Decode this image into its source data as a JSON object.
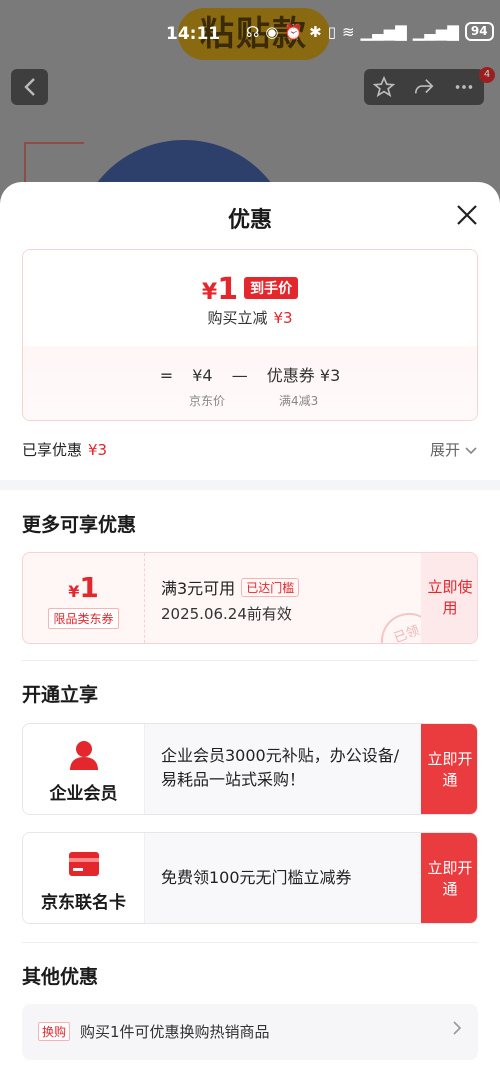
{
  "background": {
    "banner_text": "粘贴款",
    "status": {
      "time": "14:11",
      "battery": "94"
    },
    "nav_badge": "4"
  },
  "sheet": {
    "title": "优惠",
    "price": {
      "yen": "¥",
      "amount": "1",
      "tag": "到手价",
      "sub_label": "购买立减",
      "sub_value": "¥3",
      "formula_eq": "=",
      "formula_price": "¥4",
      "formula_minus": "—",
      "formula_coupon": "优惠券 ¥3",
      "formula_price_label": "京东价",
      "formula_coupon_label": "满4减3"
    },
    "enjoyed_label": "已享优惠",
    "enjoyed_value": "¥3",
    "expand_label": "展开"
  },
  "more_offers": {
    "title": "更多可享优惠",
    "coupon": {
      "yen": "¥",
      "amount": "1",
      "type": "限品类东券",
      "condition": "满3元可用",
      "badge": "已达门槛",
      "valid": "2025.06.24前有效",
      "action": "立即使用",
      "stamp": "已领"
    }
  },
  "open_enjoy": {
    "title": "开通立享",
    "items": [
      {
        "name": "企业会员",
        "desc": " 企业会员3000元补贴，办公设备/易耗品一站式采购！",
        "action": "立即开通"
      },
      {
        "name": "京东联名卡",
        "desc": "免费领100元无门槛立减券",
        "action": "立即开通"
      }
    ]
  },
  "other_offers": {
    "title": "其他优惠",
    "tag": "换购",
    "text": "购买1件可优惠换购热销商品"
  },
  "colors": {
    "accent": "#e4272c",
    "button": "#ea3b3f"
  }
}
